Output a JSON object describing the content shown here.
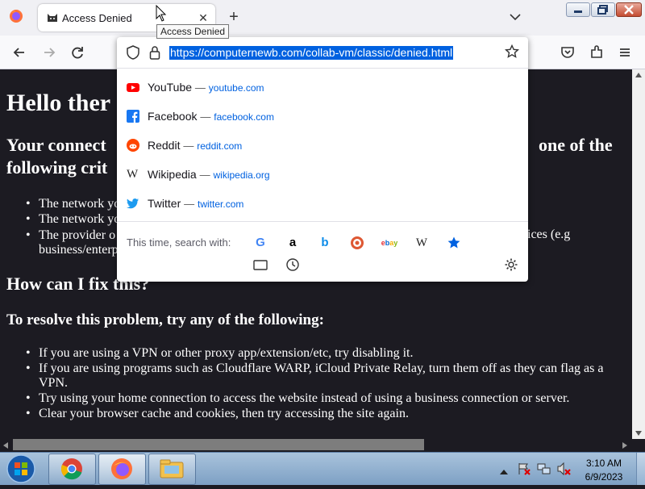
{
  "tab": {
    "title": "Access Denied",
    "tooltip": "Access Denied"
  },
  "urlbar": {
    "url": "https://computernewb.com/collab-vm/classic/denied.html"
  },
  "suggestions": [
    {
      "title": "YouTube",
      "url": "youtube.com",
      "icon": "youtube-icon"
    },
    {
      "title": "Facebook",
      "url": "facebook.com",
      "icon": "facebook-icon"
    },
    {
      "title": "Reddit",
      "url": "reddit.com",
      "icon": "reddit-icon"
    },
    {
      "title": "Wikipedia",
      "url": "wikipedia.org",
      "icon": "wikipedia-icon"
    },
    {
      "title": "Twitter",
      "url": "twitter.com",
      "icon": "twitter-icon"
    }
  ],
  "search": {
    "label": "This time, search with:",
    "engines": [
      "google-icon",
      "amazon-icon",
      "bing-icon",
      "duckduckgo-icon",
      "ebay-icon",
      "wikipedia-icon",
      "bookmarks-icon",
      "tabs-icon",
      "history-icon",
      "settings-icon"
    ]
  },
  "page": {
    "h1": "Hello ther",
    "h2_line1_left": "Your connect",
    "h2_line1_right": "one of the",
    "h2_line2": "following crit",
    "criteria": [
      "The network yo",
      "The network yo",
      "The provider o",
      "business/enterp"
    ],
    "criteria_right": "ices (e.g",
    "fix_heading": "How can I fix this?",
    "resolve_heading": "To resolve this problem, try any of the following:",
    "steps": [
      "If you are using a VPN or other proxy app/extension/etc, try disabling it.",
      "If you are using programs such as Cloudflare WARP, iCloud Private Relay, turn them off as they can flag as a",
      "VPN.",
      "Try using your home connection to access the website instead of using a business connection or server.",
      "Clear your browser cache and cookies, then try accessing the site again."
    ]
  },
  "taskbar": {
    "time": "3:10 AM",
    "date": "6/9/2023",
    "apps": [
      "chrome-icon",
      "firefox-icon",
      "explorer-icon"
    ]
  },
  "colors": {
    "page_bg": "#1c1b22",
    "accent": "#0061e0"
  }
}
